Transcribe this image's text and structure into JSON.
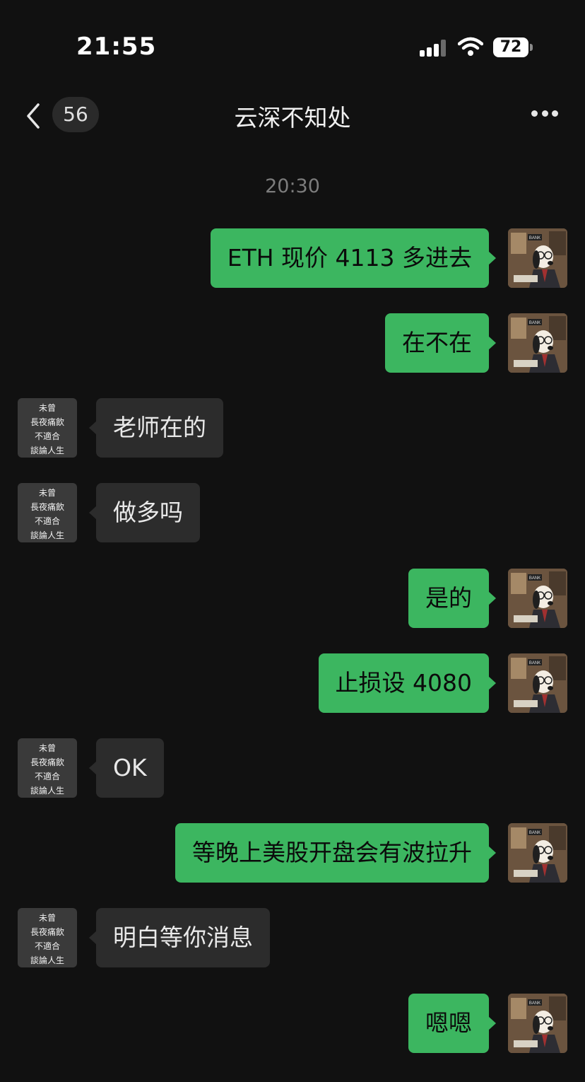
{
  "status": {
    "time": "21:55",
    "battery": "72"
  },
  "nav": {
    "unread_count": "56",
    "title": "云深不知处"
  },
  "timestamp": "20:30",
  "avatar_self": {
    "sign_text": "BANK"
  },
  "avatar_other": {
    "lines": [
      "未曾",
      "長夜痛飲",
      "不適合",
      "談論人生"
    ]
  },
  "messages": [
    {
      "dir": "out",
      "text": "ETH 现价 4113 多进去"
    },
    {
      "dir": "out",
      "text": "在不在"
    },
    {
      "dir": "in",
      "text": "老师在的"
    },
    {
      "dir": "in",
      "text": "做多吗"
    },
    {
      "dir": "out",
      "text": "是的"
    },
    {
      "dir": "out",
      "text": "止损设 4080"
    },
    {
      "dir": "in",
      "text": "OK"
    },
    {
      "dir": "out",
      "text": "等晚上美股开盘会有波拉升"
    },
    {
      "dir": "in",
      "text": "明白等你消息"
    },
    {
      "dir": "out",
      "text": "嗯嗯"
    }
  ],
  "colors": {
    "background": "#111111",
    "outgoing_bubble": "#3cb660",
    "incoming_bubble": "#2c2c2c"
  }
}
